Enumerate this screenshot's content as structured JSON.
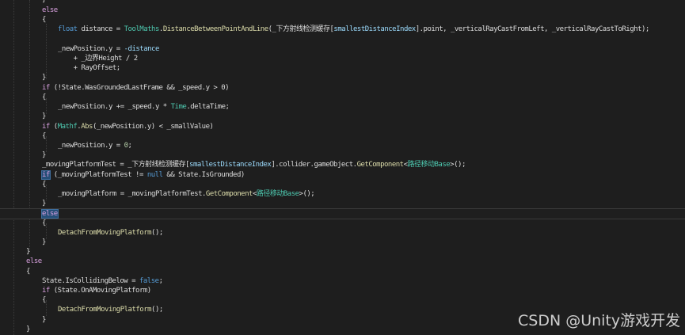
{
  "editor": {
    "lines": [
      {
        "id": "l0",
        "indent": 0,
        "tokens": [
          {
            "t": "}",
            "c": "plain"
          }
        ]
      },
      {
        "id": "l1",
        "indent": 0,
        "tokens": [
          {
            "t": "else",
            "c": "control"
          }
        ]
      },
      {
        "id": "l2",
        "indent": 0,
        "tokens": [
          {
            "t": "{",
            "c": "plain"
          }
        ]
      },
      {
        "id": "l3",
        "indent": 0,
        "tokens": [
          {
            "t": "float",
            "c": "keyword"
          },
          {
            "t": " distance = ",
            "c": "plain"
          },
          {
            "t": "ToolMaths",
            "c": "type"
          },
          {
            "t": ".",
            "c": "plain"
          },
          {
            "t": "DistanceBetweenPointAndLine",
            "c": "method"
          },
          {
            "t": "(_下方射线检测缓存[",
            "c": "plain"
          },
          {
            "t": "smallestDistanceIndex",
            "c": "field"
          },
          {
            "t": "].point, _verticalRayCastFromLeft, _verticalRayCastToRight);",
            "c": "plain"
          }
        ]
      },
      {
        "id": "l4",
        "indent": 0,
        "tokens": []
      },
      {
        "id": "l5",
        "indent": 0,
        "tokens": [
          {
            "t": "_newPosition.y = ",
            "c": "plain"
          },
          {
            "t": "-distance",
            "c": "field"
          }
        ]
      },
      {
        "id": "l6",
        "indent": 0,
        "tokens": [
          {
            "t": "    + _边界Height / 2",
            "c": "plain"
          }
        ]
      },
      {
        "id": "l7",
        "indent": 0,
        "tokens": [
          {
            "t": "    + RayOffset;",
            "c": "plain"
          }
        ]
      },
      {
        "id": "l8",
        "indent": 0,
        "tokens": [
          {
            "t": "}",
            "c": "plain"
          }
        ]
      },
      {
        "id": "l9",
        "indent": 0,
        "tokens": [
          {
            "t": "if",
            "c": "control"
          },
          {
            "t": " (!State.WasGroundedLastFrame && _speed.y > 0)",
            "c": "plain"
          }
        ]
      },
      {
        "id": "l10",
        "indent": 0,
        "tokens": [
          {
            "t": "{",
            "c": "plain"
          }
        ]
      },
      {
        "id": "l11",
        "indent": 0,
        "tokens": [
          {
            "t": "_newPosition.y += _speed.y * ",
            "c": "plain"
          },
          {
            "t": "Time",
            "c": "type"
          },
          {
            "t": ".deltaTime;",
            "c": "plain"
          }
        ]
      },
      {
        "id": "l12",
        "indent": 0,
        "tokens": [
          {
            "t": "}",
            "c": "plain"
          }
        ]
      },
      {
        "id": "l13",
        "indent": 0,
        "tokens": [
          {
            "t": "if",
            "c": "control"
          },
          {
            "t": " (",
            "c": "plain"
          },
          {
            "t": "Mathf",
            "c": "type"
          },
          {
            "t": ".",
            "c": "plain"
          },
          {
            "t": "Abs",
            "c": "method"
          },
          {
            "t": "(_newPosition.y) < _smallValue)",
            "c": "plain"
          }
        ]
      },
      {
        "id": "l14",
        "indent": 0,
        "tokens": [
          {
            "t": "{",
            "c": "plain"
          }
        ]
      },
      {
        "id": "l15",
        "indent": 0,
        "tokens": [
          {
            "t": "_newPosition.y = ",
            "c": "plain"
          },
          {
            "t": "0",
            "c": "number"
          },
          {
            "t": ";",
            "c": "plain"
          }
        ]
      },
      {
        "id": "l16",
        "indent": 0,
        "tokens": [
          {
            "t": "}",
            "c": "plain"
          }
        ]
      },
      {
        "id": "l17",
        "indent": 0,
        "tokens": [
          {
            "t": "_movingPlatformTest = _下方射线检测缓存[",
            "c": "plain"
          },
          {
            "t": "smallestDistanceIndex",
            "c": "field"
          },
          {
            "t": "].collider.gameObject.",
            "c": "plain"
          },
          {
            "t": "GetComponent",
            "c": "method"
          },
          {
            "t": "<",
            "c": "plain"
          },
          {
            "t": "路径移动Base",
            "c": "type"
          },
          {
            "t": ">();",
            "c": "plain"
          }
        ]
      },
      {
        "id": "l18",
        "indent": 0,
        "tokens": [
          {
            "t": "if",
            "c": "control-hl"
          },
          {
            "t": " (_movingPlatformTest != ",
            "c": "plain"
          },
          {
            "t": "null",
            "c": "keyword"
          },
          {
            "t": " && State.IsGrounded)",
            "c": "plain"
          }
        ]
      },
      {
        "id": "l19",
        "indent": 0,
        "tokens": [
          {
            "t": "{",
            "c": "plain"
          }
        ]
      },
      {
        "id": "l20",
        "indent": 0,
        "tokens": [
          {
            "t": "_movingPlatform = _movingPlatformTest.",
            "c": "plain"
          },
          {
            "t": "GetComponent",
            "c": "method"
          },
          {
            "t": "<",
            "c": "plain"
          },
          {
            "t": "路径移动Base",
            "c": "type"
          },
          {
            "t": ">();",
            "c": "plain"
          }
        ]
      },
      {
        "id": "l21",
        "indent": 0,
        "tokens": [
          {
            "t": "}",
            "c": "plain"
          }
        ]
      },
      {
        "id": "l22",
        "indent": 0,
        "tokens": [
          {
            "t": "else",
            "c": "control-hl"
          }
        ]
      },
      {
        "id": "l23",
        "indent": 0,
        "tokens": [
          {
            "t": "{",
            "c": "plain"
          }
        ]
      },
      {
        "id": "l24",
        "indent": 0,
        "tokens": [
          {
            "t": "DetachFromMovingPlatform",
            "c": "method"
          },
          {
            "t": "();",
            "c": "plain"
          }
        ]
      },
      {
        "id": "l25",
        "indent": 0,
        "tokens": [
          {
            "t": "}",
            "c": "plain"
          }
        ]
      },
      {
        "id": "l26",
        "indent": 0,
        "tokens": [
          {
            "t": "}",
            "c": "plain"
          }
        ]
      },
      {
        "id": "l27",
        "indent": 0,
        "tokens": [
          {
            "t": "else",
            "c": "control"
          }
        ]
      },
      {
        "id": "l28",
        "indent": 0,
        "tokens": [
          {
            "t": "{",
            "c": "plain"
          }
        ]
      },
      {
        "id": "l29",
        "indent": 0,
        "tokens": [
          {
            "t": "State.IsCollidingBelow = ",
            "c": "plain"
          },
          {
            "t": "false",
            "c": "keyword"
          },
          {
            "t": ";",
            "c": "plain"
          }
        ]
      },
      {
        "id": "l30",
        "indent": 0,
        "tokens": [
          {
            "t": "if",
            "c": "control"
          },
          {
            "t": " (State.OnAMovingPlatform)",
            "c": "plain"
          }
        ]
      },
      {
        "id": "l31",
        "indent": 0,
        "tokens": [
          {
            "t": "{",
            "c": "plain"
          }
        ]
      },
      {
        "id": "l32",
        "indent": 0,
        "tokens": [
          {
            "t": "DetachFromMovingPlatform",
            "c": "method"
          },
          {
            "t": "();",
            "c": "plain"
          }
        ]
      },
      {
        "id": "l33",
        "indent": 0,
        "tokens": [
          {
            "t": "}",
            "c": "plain"
          }
        ]
      },
      {
        "id": "l34",
        "indent": 0,
        "tokens": [
          {
            "t": "}",
            "c": "plain"
          }
        ]
      }
    ]
  },
  "watermark": "CSDN @Unity游戏开发",
  "colors": {
    "background": "#1e1e1e",
    "keyword": "#569cd6",
    "control": "#d8a0df",
    "type": "#4ec9b0",
    "method": "#dcdcaa",
    "field": "#9cdcfe",
    "number": "#b5cea8",
    "plain": "#dcdcdc"
  }
}
